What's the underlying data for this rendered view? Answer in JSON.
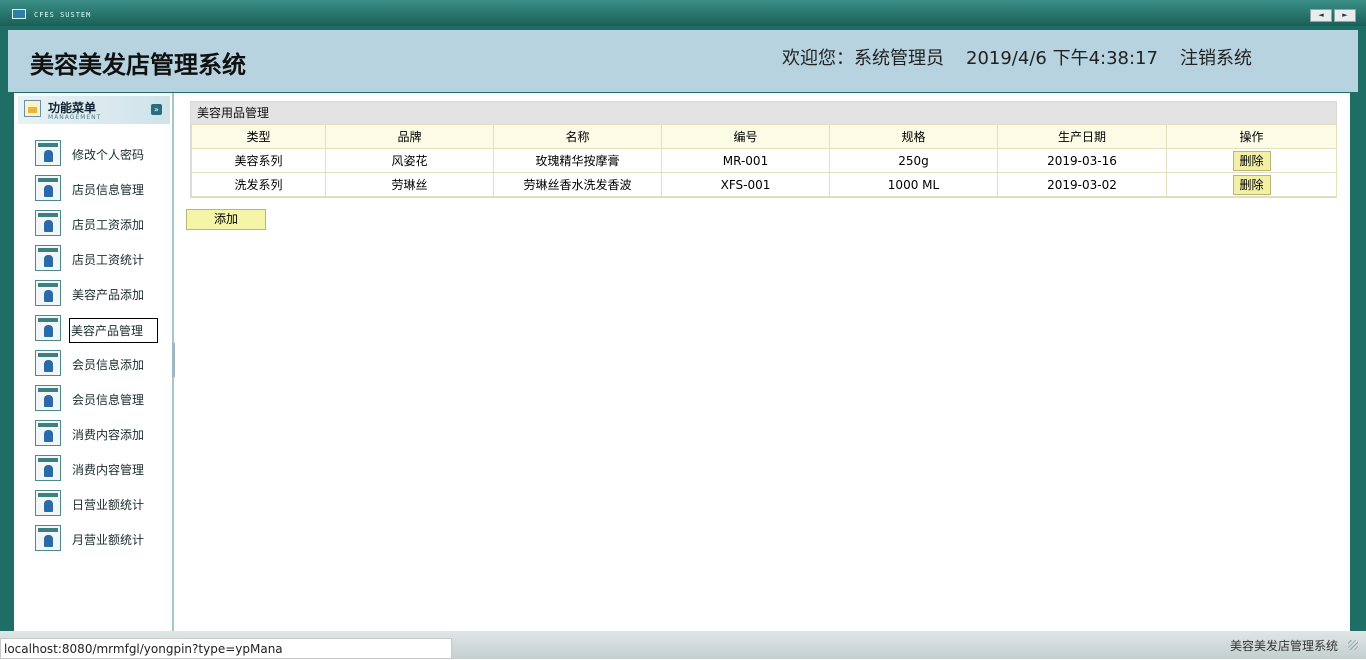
{
  "window": {
    "system_title": "CFES SUSTEM",
    "btn_prev": "◄",
    "btn_next": "►"
  },
  "header": {
    "title": "美容美发店管理系统",
    "welcome": "欢迎您：系统管理员",
    "datetime": "2019/4/6 下午4:38:17",
    "logout": "注销系统"
  },
  "sidebar": {
    "title": "功能菜单",
    "subtitle": "MANAGEMENT",
    "items": [
      {
        "label": "修改个人密码"
      },
      {
        "label": "店员信息管理"
      },
      {
        "label": "店员工资添加"
      },
      {
        "label": "店员工资统计"
      },
      {
        "label": "美容产品添加"
      },
      {
        "label": "美容产品管理",
        "active": true
      },
      {
        "label": "会员信息添加"
      },
      {
        "label": "会员信息管理"
      },
      {
        "label": "消费内容添加"
      },
      {
        "label": "消费内容管理"
      },
      {
        "label": "日营业额统计"
      },
      {
        "label": "月营业额统计"
      }
    ]
  },
  "panel": {
    "title": "美容用品管理",
    "columns": [
      "类型",
      "品牌",
      "名称",
      "编号",
      "规格",
      "生产日期",
      "操作"
    ],
    "rows": [
      {
        "type": "美容系列",
        "brand": "风姿花",
        "name": "玫瑰精华按摩膏",
        "code": "MR-001",
        "spec": "250g",
        "date": "2019-03-16",
        "action": "删除"
      },
      {
        "type": "洗发系列",
        "brand": "劳琳丝",
        "name": "劳琳丝香水洗发香波",
        "code": "XFS-001",
        "spec": "1000 ML",
        "date": "2019-03-02",
        "action": "删除"
      }
    ],
    "add_label": "添加"
  },
  "status": {
    "url": "localhost:8080/mrmfgl/yongpin?type=ypMana",
    "app_name": "美容美发店管理系统"
  }
}
